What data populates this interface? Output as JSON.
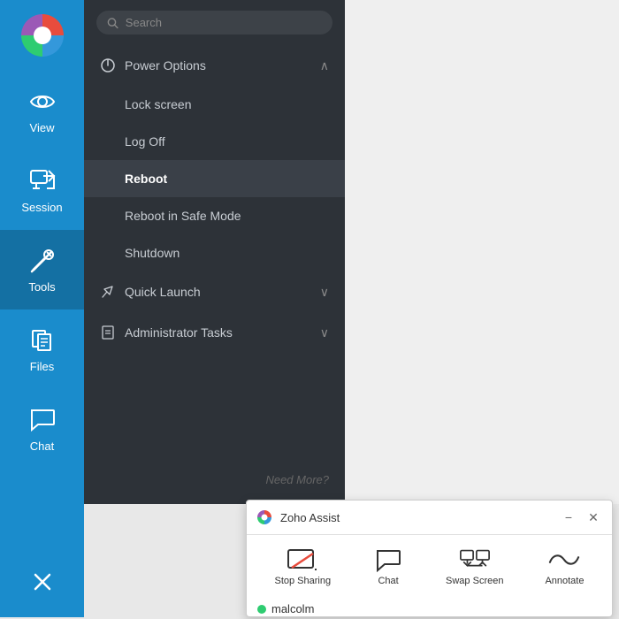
{
  "sidebar": {
    "items": [
      {
        "id": "view",
        "label": "View",
        "active": false
      },
      {
        "id": "session",
        "label": "Session",
        "active": false
      },
      {
        "id": "tools",
        "label": "Tools",
        "active": true
      },
      {
        "id": "files",
        "label": "Files",
        "active": false
      },
      {
        "id": "chat",
        "label": "Chat",
        "active": false
      }
    ],
    "close_label": "✕"
  },
  "search": {
    "placeholder": "Search"
  },
  "menu": {
    "power_options": {
      "label": "Power Options",
      "expanded": true,
      "items": [
        {
          "id": "lock-screen",
          "label": "Lock screen",
          "highlighted": false
        },
        {
          "id": "log-off",
          "label": "Log Off",
          "highlighted": false
        },
        {
          "id": "reboot",
          "label": "Reboot",
          "highlighted": true
        },
        {
          "id": "reboot-safe",
          "label": "Reboot in Safe Mode",
          "highlighted": false
        },
        {
          "id": "shutdown",
          "label": "Shutdown",
          "highlighted": false
        }
      ]
    },
    "quick_launch": {
      "label": "Quick Launch",
      "expanded": false
    },
    "admin_tasks": {
      "label": "Administrator Tasks",
      "expanded": false
    },
    "need_more": "Need More?"
  },
  "zoho_assist": {
    "title": "Zoho Assist",
    "toolbar_buttons": [
      {
        "id": "stop-sharing",
        "label": "Stop Sharing"
      },
      {
        "id": "chat",
        "label": "Chat"
      },
      {
        "id": "swap-screen",
        "label": "Swap Screen"
      },
      {
        "id": "annotate",
        "label": "Annotate"
      }
    ],
    "user": {
      "name": "malcolm",
      "status": "online"
    }
  }
}
